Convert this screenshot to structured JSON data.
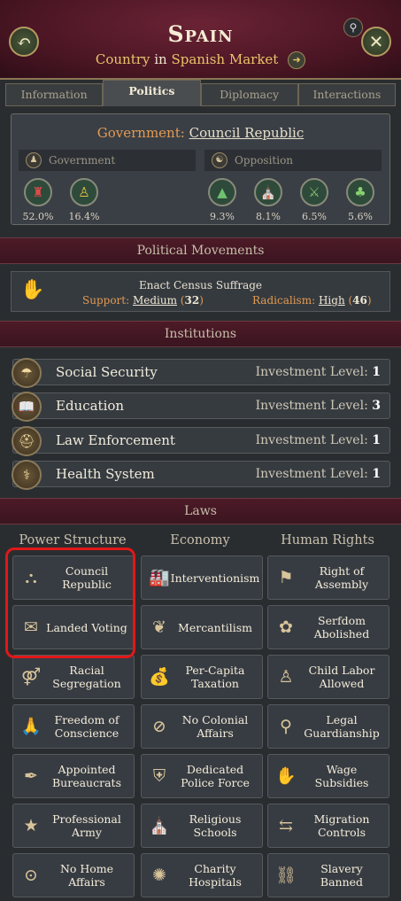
{
  "header": {
    "title": "Spain",
    "subtitle_type": "Country",
    "subtitle_in": "in",
    "subtitle_market": "Spanish Market",
    "back_icon": "back-arrow-icon",
    "close_icon": "close-icon",
    "search_icon": "magnifier-icon",
    "goto_icon": "play-arrow-icon"
  },
  "tabs": [
    {
      "label": "Information"
    },
    {
      "label": "Politics"
    },
    {
      "label": "Diplomacy"
    },
    {
      "label": "Interactions"
    }
  ],
  "active_tab": "Politics",
  "government": {
    "prefix": "Government:",
    "type": "Council Republic",
    "gov_label": "Government",
    "opp_label": "Opposition",
    "government_groups": [
      {
        "icon": "landowners-icon",
        "pct": "52.0%"
      },
      {
        "icon": "petite-bourgeoisie-icon",
        "pct": "16.4%"
      }
    ],
    "opposition_groups": [
      {
        "icon": "armed-forces-icon",
        "pct": "9.3%"
      },
      {
        "icon": "clergy-icon",
        "pct": "8.1%"
      },
      {
        "icon": "rural-folk-icon",
        "pct": "6.5%"
      },
      {
        "icon": "intelligentsia-icon",
        "pct": "5.6%"
      }
    ]
  },
  "political_movements": {
    "heading": "Political Movements",
    "movement_title_prefix": "Enact",
    "movement_law": "Census Suffrage",
    "support_label": "Support:",
    "support_value": "Medium",
    "support_num": "32",
    "radicalism_label": "Radicalism:",
    "radicalism_value": "High",
    "radicalism_num": "46"
  },
  "institutions": {
    "heading": "Institutions",
    "level_label": "Investment Level:",
    "items": [
      {
        "name": "Social Security",
        "level": "1",
        "icon": "social-security-icon"
      },
      {
        "name": "Education",
        "level": "3",
        "icon": "book-icon"
      },
      {
        "name": "Law Enforcement",
        "level": "1",
        "icon": "police-helmet-icon"
      },
      {
        "name": "Health System",
        "level": "1",
        "icon": "caduceus-icon"
      }
    ]
  },
  "laws": {
    "heading": "Laws",
    "columns": [
      {
        "title": "Power Structure",
        "items": [
          "Council Republic",
          "Landed Voting",
          "Racial Segregation",
          "Freedom of Conscience",
          "Appointed Bureaucrats",
          "Professional Army",
          "No Home Affairs"
        ]
      },
      {
        "title": "Economy",
        "items": [
          "Interventionism",
          "Mercantilism",
          "Per-Capita Taxation",
          "No Colonial Affairs",
          "Dedicated Police Force",
          "Religious Schools",
          "Charity Hospitals"
        ]
      },
      {
        "title": "Human Rights",
        "items": [
          "Right of Assembly",
          "Serfdom Abolished",
          "Child Labor Allowed",
          "Legal Guardianship",
          "Wage Subsidies",
          "Migration Controls",
          "Slavery Banned"
        ]
      }
    ]
  },
  "colors": {
    "header_bg": "#4c1624",
    "accent_orange": "#e39a52",
    "accent_gold": "#e9c46a",
    "highlight_red": "#e01818"
  }
}
